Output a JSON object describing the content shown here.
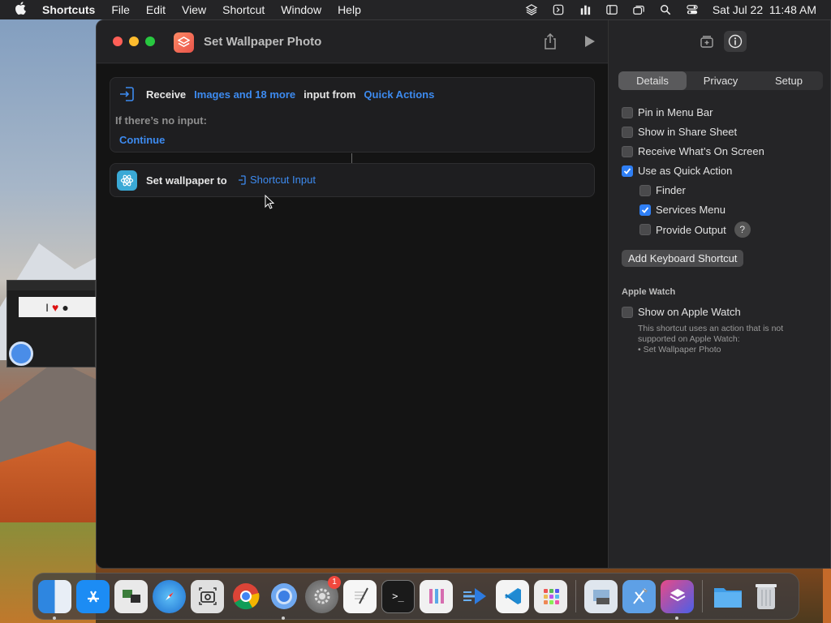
{
  "menubar": {
    "app_name": "Shortcuts",
    "menus": [
      "File",
      "Edit",
      "View",
      "Shortcut",
      "Window",
      "Help"
    ],
    "clock": "Sat Jul 22  11:48 AM"
  },
  "window": {
    "title": "Set Wallpaper Photo"
  },
  "editor": {
    "receive_label": "Receive",
    "receive_types": "Images and 18 more",
    "input_from_label": "input from",
    "input_source": "Quick Actions",
    "no_input_label": "If there’s no input:",
    "no_input_action": "Continue",
    "action2_label": "Set wallpaper to",
    "action2_var": "Shortcut Input"
  },
  "sidebar": {
    "tabs": [
      "Details",
      "Privacy",
      "Setup"
    ],
    "selected_tab": "Details",
    "options": [
      {
        "label": "Pin in Menu Bar",
        "checked": false
      },
      {
        "label": "Show in Share Sheet",
        "checked": false
      },
      {
        "label": "Receive What’s On Screen",
        "checked": false
      },
      {
        "label": "Use as Quick Action",
        "checked": true
      },
      {
        "label": "Finder",
        "checked": false
      },
      {
        "label": "Services Menu",
        "checked": true
      },
      {
        "label": "Provide Output",
        "checked": false
      }
    ],
    "help_glyph": "?",
    "keyboard_button": "Add Keyboard Shortcut",
    "apple_watch_title": "Apple Watch",
    "apple_watch_option": "Show on Apple Watch",
    "apple_watch_note_1": "This shortcut uses an action that is not",
    "apple_watch_note_2": "supported on Apple Watch:",
    "apple_watch_note_3": "• Set Wallpaper Photo"
  },
  "dock": {
    "badge_count": "1"
  },
  "colors": {
    "accent": "#3d8bf0",
    "checkbox_on": "#2f7ff5",
    "window_bg": "#1d1d1f"
  }
}
